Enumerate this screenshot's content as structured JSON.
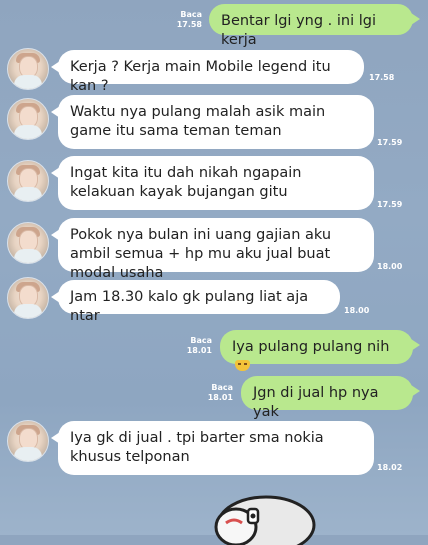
{
  "messages": [
    {
      "side": "out",
      "text": "Bentar lgi yng . ini lgi kerja",
      "read": "Baca",
      "time": "17.58"
    },
    {
      "side": "in",
      "text": "Kerja ? Kerja main Mobile legend itu kan ?",
      "time": "17.58"
    },
    {
      "side": "in",
      "text": "Waktu nya pulang malah asik main game itu sama teman teman",
      "time": "17.59"
    },
    {
      "side": "in",
      "text": "Ingat kita itu dah nikah ngapain kelakuan kayak bujangan gitu",
      "time": "17.59"
    },
    {
      "side": "in",
      "text": "Pokok nya bulan ini uang gajian aku ambil semua + hp mu aku jual buat modal usaha",
      "time": "18.00"
    },
    {
      "side": "in",
      "text": "Jam 18.30 kalo gk pulang liat aja ntar",
      "time": "18.00"
    },
    {
      "side": "out",
      "text": "Iya pulang pulang nih",
      "read": "Baca",
      "time": "18.01",
      "emoji": "grin-emoji"
    },
    {
      "side": "out",
      "text": "Jgn di jual hp nya yak",
      "read": "Baca",
      "time": "18.01"
    },
    {
      "side": "in",
      "text": "Iya gk di jual . tpi barter sma nokia khusus telponan",
      "time": "18.02"
    }
  ],
  "icons": {
    "avatar": "profile-avatar",
    "sticker": "elephant-sticker"
  },
  "colors": {
    "background": "#93aac4",
    "incoming_bubble": "#ffffff",
    "outgoing_bubble": "#b9e88e",
    "meta_text": "#ffffff"
  }
}
